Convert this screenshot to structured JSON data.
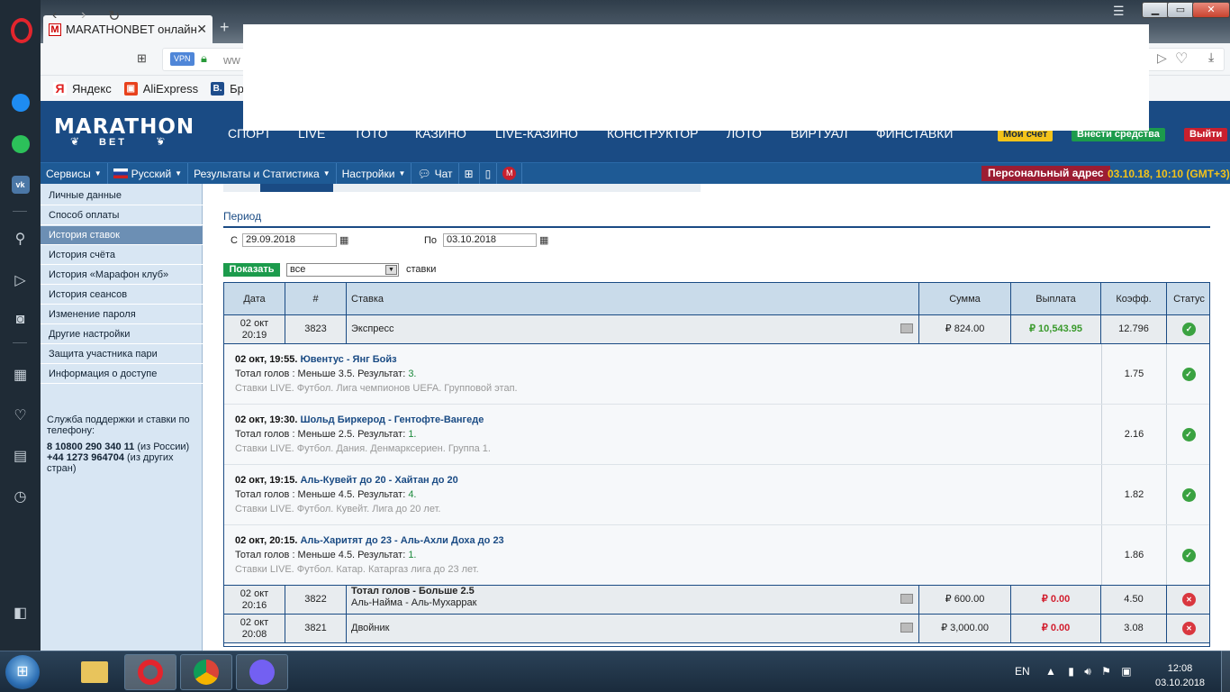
{
  "browser": {
    "tab_title": "MARATHONBET онлайн б",
    "tab_favicon": "M",
    "bookmarks": [
      {
        "label": "Яндекс",
        "icon": "Я",
        "color": "#e02020"
      },
      {
        "label": "AliExpress",
        "icon": "A",
        "color": "#e8411c"
      },
      {
        "label": "Бро",
        "icon": "B.",
        "color": "#1e4d8c"
      }
    ],
    "vpn": "VPN",
    "url_prefix": "ww"
  },
  "site": {
    "logo_main": "MARATHON",
    "logo_sub": "BET",
    "main_nav": [
      "СПОРТ",
      "LIVE",
      "ТОТО",
      "КАЗИНО",
      "LIVE-КАЗИНО",
      "КОНСТРУКТОР",
      "ЛОТО",
      "ВИРТУАЛ",
      "ФИНСТАВКИ"
    ],
    "my_account": "Мои счет",
    "deposit": "Внести средства",
    "logout": "Выйти",
    "sub_nav": {
      "services": "Сервисы",
      "language": "Русский",
      "results": "Результаты и Статистика",
      "settings": "Настройки",
      "chat": "Чат"
    },
    "personal_address": "Персональный адрес",
    "datetime": "03.10.18, 10:10 (GMT+3)"
  },
  "left_menu": [
    "Личные данные",
    "Способ оплаты",
    "История ставок",
    "История счёта",
    "История «Марафон клуб»",
    "История сеансов",
    "Изменение пароля",
    "Другие настройки",
    "Защита участника пари",
    "Информация о доступе"
  ],
  "support": {
    "text": "Служба поддержки и ставки по телефону:",
    "phone1": "8 10800 290 340 11",
    "phone1_note": " (из России)",
    "phone2": "+44 1273 964704",
    "phone2_note": " (из других стран)"
  },
  "filter": {
    "period_title": "Период",
    "from_label": "С",
    "from_value": "29.09.2018",
    "to_label": "По",
    "to_value": "03.10.2018",
    "show_button": "Показать",
    "select_value": "все",
    "select_suffix": "ставки"
  },
  "table": {
    "headers": {
      "date": "Дата",
      "num": "#",
      "bet": "Ставка",
      "sum": "Сумма",
      "payout": "Выплата",
      "coef": "Коэфф.",
      "status": "Статус"
    },
    "express": {
      "date1": "02 окт",
      "date2": "20:19",
      "num": "3823",
      "bet": "Экспресс",
      "sum": "₽ 824.00",
      "payout": "₽ 10,543.95",
      "coef": "12.796"
    },
    "legs": [
      {
        "time": "02 окт, 19:55. ",
        "match": "Ювентус - Янг Бойз",
        "market": "Тотал голов : Меньше 3.5. Результат: ",
        "result": "3.",
        "info": "Ставки LIVE. Футбол. Лига чемпионов UEFA. Групповой этап.",
        "coef": "1.75"
      },
      {
        "time": "02 окт, 19:30. ",
        "match": "Шольд Биркерод - Гентофте-Вангеде",
        "market": "Тотал голов : Меньше 2.5. Результат: ",
        "result": "1.",
        "info": "Ставки LIVE. Футбол. Дания. Денмарксериен. Группа 1.",
        "coef": "2.16"
      },
      {
        "time": "02 окт, 19:15. ",
        "match": "Аль-Кувейт до 20 - Хайтан до 20",
        "market": "Тотал голов : Меньше 4.5. Результат: ",
        "result": "4.",
        "info": "Ставки LIVE. Футбол. Кувейт. Лига до 20 лет.",
        "coef": "1.82"
      },
      {
        "time": "02 окт, 20:15. ",
        "match": "Аль-Харитят до 23 - Аль-Ахли Доха до 23",
        "market": "Тотал голов : Меньше 4.5. Результат: ",
        "result": "1.",
        "info": "Ставки LIVE. Футбол. Катар. Катаргаз лига до 23 лет.",
        "coef": "1.86"
      }
    ],
    "row2": {
      "date1": "02 окт",
      "date2": "20:16",
      "num": "3822",
      "bet": "Тотал голов - Больше 2.5",
      "bet2": "Аль-Найма - Аль-Мухаррак",
      "sum": "₽ 600.00",
      "payout": "₽ 0.00",
      "coef": "4.50"
    },
    "row3": {
      "date1": "02 окт",
      "date2": "20:08",
      "num": "3821",
      "bet": "Двойник",
      "sum": "₽ 3,000.00",
      "payout": "₽ 0.00",
      "coef": "3.08"
    }
  },
  "taskbar": {
    "lang": "EN",
    "time": "12:08",
    "date": "03.10.2018"
  }
}
